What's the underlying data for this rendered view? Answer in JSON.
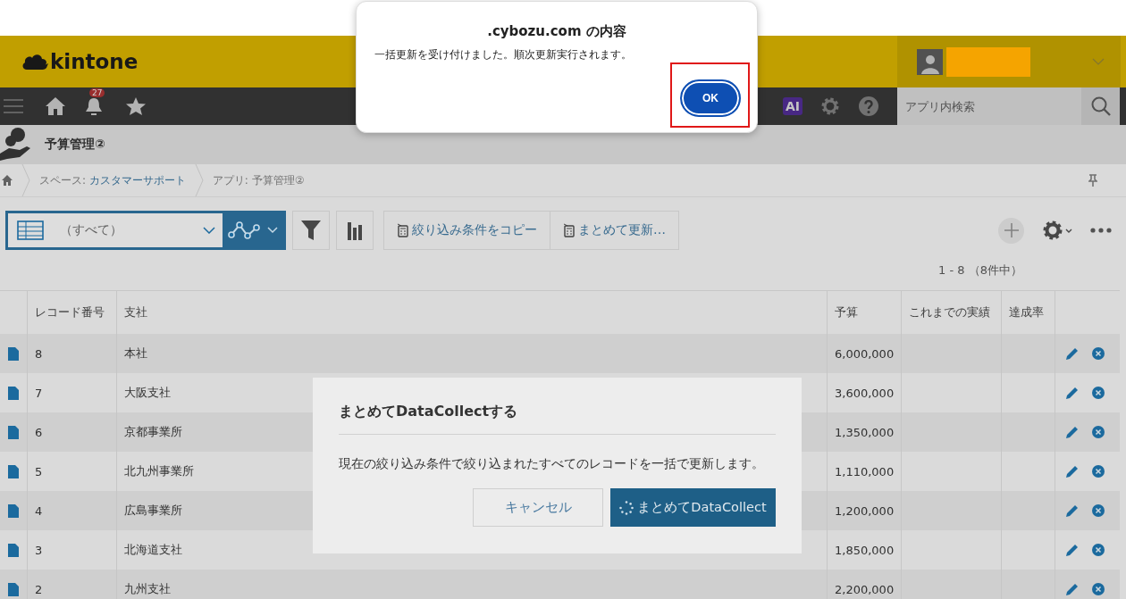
{
  "header": {
    "logo_text": "kintone"
  },
  "navbar": {
    "notification_count": "27",
    "ai_label": "AI",
    "search_placeholder": "アプリ内検索"
  },
  "app": {
    "title": "予算管理②"
  },
  "breadcrumb": [
    {
      "prefix": "スペース: ",
      "link": "カスタマーサポート"
    },
    {
      "prefix": "アプリ: 予算管理②"
    }
  ],
  "toolbar": {
    "view": "（すべて）",
    "buttons": [
      "絞り込み条件をコピー",
      "まとめて更新…"
    ]
  },
  "pager": "1 - 8 （8件中）",
  "table": {
    "columns": [
      "レコード番号",
      "支社",
      "予算",
      "これまでの実績",
      "達成率"
    ],
    "rows": [
      {
        "cells": [
          "8",
          "本社",
          "6,000,000",
          "",
          ""
        ]
      },
      {
        "cells": [
          "7",
          "大阪支社",
          "3,600,000",
          "",
          ""
        ]
      },
      {
        "cells": [
          "6",
          "京都事業所",
          "1,350,000",
          "",
          ""
        ]
      },
      {
        "cells": [
          "5",
          "北九州事業所",
          "1,110,000",
          "",
          ""
        ]
      },
      {
        "cells": [
          "4",
          "広島事業所",
          "1,200,000",
          "",
          ""
        ]
      },
      {
        "cells": [
          "3",
          "北海道支社",
          "1,850,000",
          "",
          ""
        ]
      },
      {
        "cells": [
          "2",
          "九州支社",
          "2,200,000",
          "",
          ""
        ]
      }
    ]
  },
  "modal": {
    "title": "まとめてDataCollectする",
    "message": "現在の絞り込み条件で絞り込まれたすべてのレコードを一括で更新します。",
    "cancel": "キャンセル",
    "confirm": "まとめてDataCollect"
  },
  "alert": {
    "title": ".cybozu.com の内容",
    "message": "一括更新を受け付けました。順次更新実行されます。",
    "ok": "OK"
  }
}
